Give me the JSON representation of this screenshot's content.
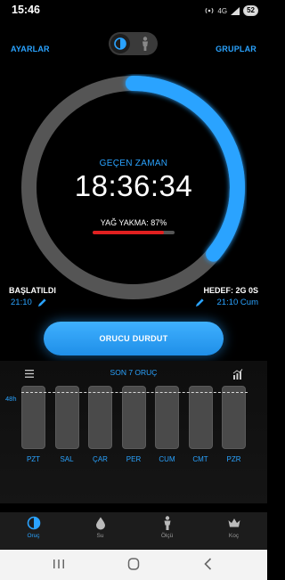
{
  "status_bar": {
    "time": "15:46",
    "net": "4G",
    "battery": "52"
  },
  "header": {
    "settings_label": "AYARLAR",
    "groups_label": "GRUPLAR"
  },
  "timer": {
    "elapsed_label": "GEÇEN ZAMAN",
    "elapsed_time": "18:36:34",
    "fat_burn_label": "YAĞ YAKMA: 87%",
    "fat_burn_percent": 87,
    "ring_progress_percent": 36
  },
  "start": {
    "title": "BAŞLATILDI",
    "value": "21:10"
  },
  "goal": {
    "title": "HEDEF: 2G 0S",
    "value": "21:10 Cum"
  },
  "actions": {
    "stop_label": "ORUCU DURDUT"
  },
  "last7": {
    "title": "SON 7 ORUÇ",
    "target_label": "48h",
    "days": [
      "PZT",
      "SAL",
      "ÇAR",
      "PER",
      "CUM",
      "CMT",
      "PZR"
    ]
  },
  "bottom_nav": [
    {
      "label": "Oruç",
      "icon": "fasting-icon",
      "active": true
    },
    {
      "label": "Su",
      "icon": "water-drop-icon",
      "active": false
    },
    {
      "label": "Ölçü",
      "icon": "body-measure-icon",
      "active": false
    },
    {
      "label": "Koç",
      "icon": "crown-icon",
      "active": false
    }
  ],
  "colors": {
    "accent": "#2aa3ff",
    "ring_track": "#555555",
    "fat_bar": "#e02020"
  }
}
